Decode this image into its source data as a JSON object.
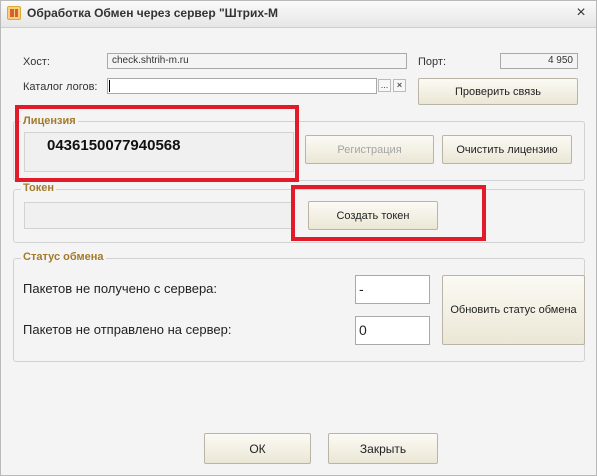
{
  "window": {
    "title": "Обработка  Обмен через сервер \"Штрих-М",
    "close_icon": "×"
  },
  "connection": {
    "host_label": "Хост:",
    "host_value": "check.shtrih-m.ru",
    "port_label": "Порт:",
    "port_value": "4 950",
    "log_dir_label": "Каталог логов:",
    "log_dir_value": "",
    "browse_label": "...",
    "clear_label": "×",
    "check_button": "Проверить связь"
  },
  "license": {
    "title": "Лицензия",
    "number": "0436150077940568",
    "register_button": "Регистрация",
    "clear_button": "Очистить лицензию"
  },
  "token": {
    "title": "Токен",
    "value": "",
    "create_button": "Создать токен"
  },
  "exchange_status": {
    "title": "Статус обмена",
    "not_received_label": "Пакетов не получено с сервера:",
    "not_received_value": "-",
    "not_sent_label": "Пакетов не отправлено на сервер:",
    "not_sent_value": "0",
    "refresh_button": "Обновить статус обмена"
  },
  "footer": {
    "ok_button": "ОК",
    "close_button": "Закрыть"
  },
  "colors": {
    "group_title": "#a37a2c",
    "highlight": "#e21b2a",
    "window_bg": "#f4f4f4"
  }
}
